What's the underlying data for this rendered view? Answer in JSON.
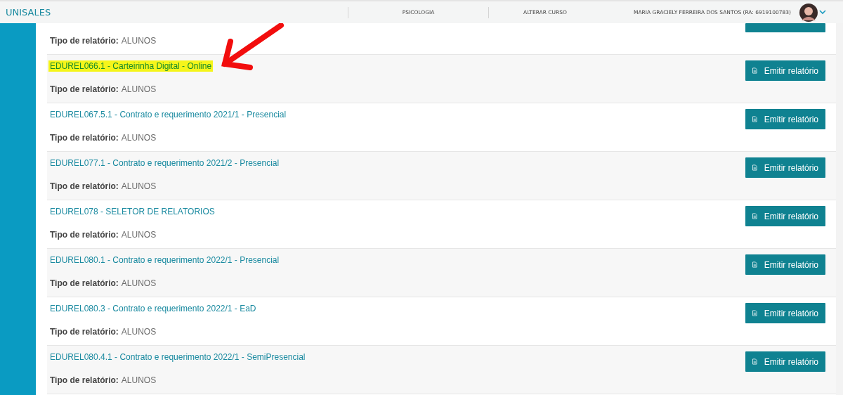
{
  "header": {
    "brand": "UNISALES",
    "menu": [
      "PSICOLOGIA",
      "ALTERAR CURSO"
    ],
    "user": "MARIA GRACIELY FERREIRA DOS SANTOS (RA: 6919100783)"
  },
  "reports": [
    {
      "type_label": "Tipo de relatório:",
      "type_value": "ALUNOS"
    },
    {
      "title": "EDUREL066.1 - Carteirinha Digital - Online",
      "type_label": "Tipo de relatório:",
      "type_value": "ALUNOS",
      "button": "Emitir relatório",
      "highlighted": true
    },
    {
      "title": "EDUREL067.5.1 - Contrato e requerimento 2021/1 - Presencial",
      "type_label": "Tipo de relatório:",
      "type_value": "ALUNOS",
      "button": "Emitir relatório",
      "highlighted": false
    },
    {
      "title": "EDUREL077.1 - Contrato e requerimento 2021/2 - Presencial",
      "type_label": "Tipo de relatório:",
      "type_value": "ALUNOS",
      "button": "Emitir relatório",
      "highlighted": false
    },
    {
      "title": "EDUREL078 - SELETOR DE RELATORIOS",
      "type_label": "Tipo de relatório:",
      "type_value": "ALUNOS",
      "button": "Emitir relatório",
      "highlighted": false
    },
    {
      "title": "EDUREL080.1 - Contrato e requerimento 2022/1 - Presencial",
      "type_label": "Tipo de relatório:",
      "type_value": "ALUNOS",
      "button": "Emitir relatório",
      "highlighted": false
    },
    {
      "title": "EDUREL080.3 - Contrato e requerimento 2022/1 - EaD",
      "type_label": "Tipo de relatório:",
      "type_value": "ALUNOS",
      "button": "Emitir relatório",
      "highlighted": false
    },
    {
      "title": "EDUREL080.4.1 - Contrato e requerimento 2022/1 - SemiPresencial",
      "type_label": "Tipo de relatório:",
      "type_value": "ALUNOS",
      "button": "Emitir relatório",
      "highlighted": false
    }
  ]
}
